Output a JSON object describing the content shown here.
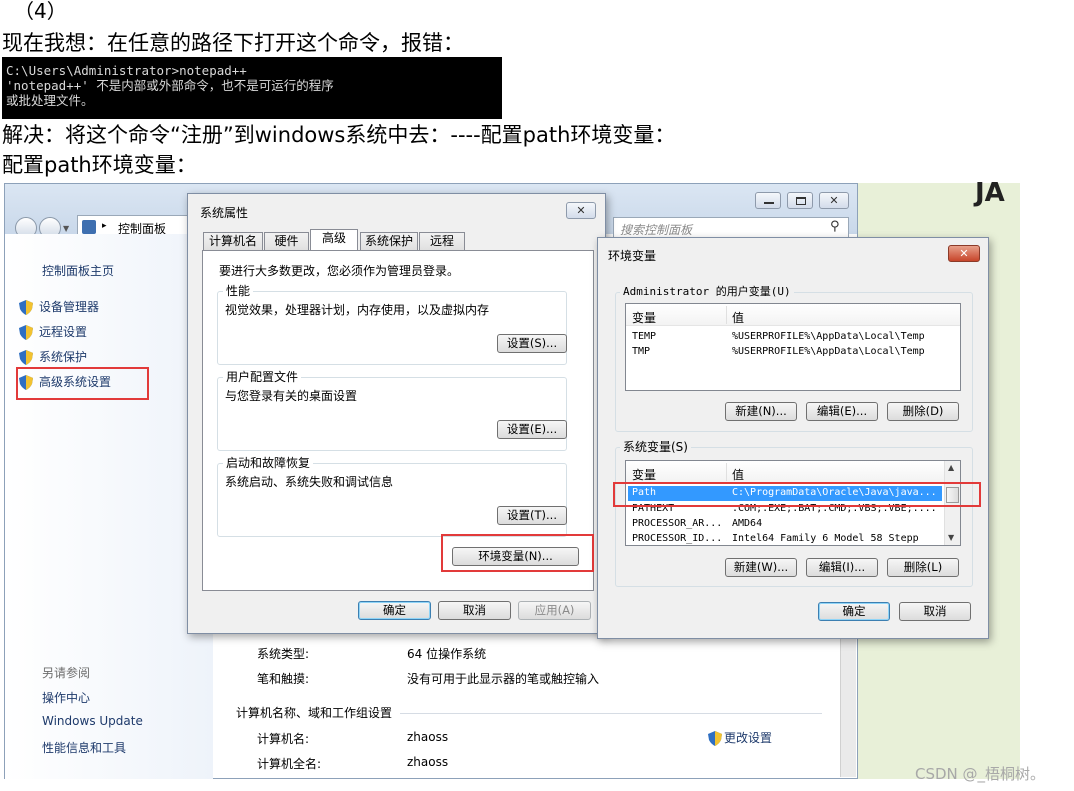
{
  "doc": {
    "step": "（4）",
    "line1": "现在我想：在任意的路径下打开这个命令，报错：",
    "terminal": [
      "C:\\Users\\Administrator>notepad++",
      "'notepad++' 不是内部或外部命令，也不是可运行的程序",
      "或批处理文件。"
    ],
    "line2": "解决：将这个命令“注册”到windows系统中去：----配置path环境变量：",
    "line3": "配置path环境变量：",
    "corner_text": "JA",
    "watermark": "CSDN @_梧桐树。"
  },
  "control_panel": {
    "breadcrumb": "控制面板",
    "search_placeholder": "搜索控制面板",
    "home": "控制面板主页",
    "links": [
      "设备管理器",
      "远程设置",
      "系统保护",
      "高级系统设置"
    ],
    "see_also": "另请参阅",
    "see_also_links": [
      "操作中心",
      "Windows Update",
      "性能信息和工具"
    ],
    "system_type_label": "系统类型:",
    "system_type_value": "64 位操作系统",
    "pen_label": "笔和触摸:",
    "pen_value": "没有可用于此显示器的笔或触控输入",
    "section_title": "计算机名称、域和工作组设置",
    "computer_name_label": "计算机名:",
    "computer_name_value": "zhaoss",
    "full_name_label": "计算机全名:",
    "full_name_value": "zhaoss",
    "change_settings": "更改设置"
  },
  "sys_props": {
    "title": "系统属性",
    "tabs": [
      "计算机名",
      "硬件",
      "高级",
      "系统保护",
      "远程"
    ],
    "admin_note": "要进行大多数更改，您必须作为管理员登录。",
    "perf_title": "性能",
    "perf_desc": "视觉效果，处理器计划，内存使用，以及虚拟内存",
    "perf_btn": "设置(S)...",
    "profile_title": "用户配置文件",
    "profile_desc": "与您登录有关的桌面设置",
    "profile_btn": "设置(E)...",
    "startup_title": "启动和故障恢复",
    "startup_desc": "系统启动、系统失败和调试信息",
    "startup_btn": "设置(T)...",
    "env_btn": "环境变量(N)...",
    "ok": "确定",
    "cancel": "取消",
    "apply": "应用(A)"
  },
  "env_vars": {
    "title": "环境变量",
    "user_group": "Administrator 的用户变量(U)",
    "col_var": "变量",
    "col_val": "值",
    "user_rows": [
      {
        "name": "TEMP",
        "value": "%USERPROFILE%\\AppData\\Local\\Temp"
      },
      {
        "name": "TMP",
        "value": "%USERPROFILE%\\AppData\\Local\\Temp"
      }
    ],
    "user_new": "新建(N)...",
    "user_edit": "编辑(E)...",
    "user_delete": "删除(D)",
    "sys_group": "系统变量(S)",
    "sys_rows": [
      {
        "name": "Path",
        "value": "C:\\ProgramData\\Oracle\\Java\\java..."
      },
      {
        "name": "PATHEXT",
        "value": ".COM;.EXE;.BAT;.CMD;.VBS;.VBE;...."
      },
      {
        "name": "PROCESSOR_AR...",
        "value": "AMD64"
      },
      {
        "name": "PROCESSOR_ID...",
        "value": "Intel64 Family 6 Model 58 Stepp"
      }
    ],
    "sys_new": "新建(W)...",
    "sys_edit": "编辑(I)...",
    "sys_delete": "删除(L)",
    "ok": "确定",
    "cancel": "取消"
  },
  "colors": {
    "highlight_red": "#e23a3a",
    "selection_blue": "#3399ff",
    "link_blue": "#1e3a6b"
  }
}
